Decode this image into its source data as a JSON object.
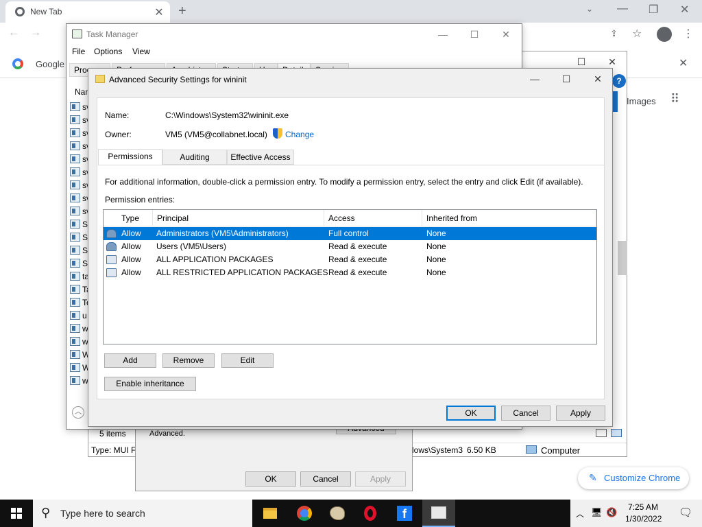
{
  "chrome": {
    "tab_title": "New Tab",
    "bookmark_google": "Google",
    "images_link": "Images",
    "customize_label": "Customize Chrome"
  },
  "task_manager": {
    "title": "Task Manager",
    "menu": [
      "File",
      "Options",
      "View"
    ],
    "tabs": [
      "Processes",
      "Performance",
      "App history",
      "Startup",
      "Users",
      "Details",
      "Services"
    ],
    "column_name": "Nam",
    "rows": [
      "sv",
      "sv",
      "sv",
      "sv",
      "sv",
      "sv",
      "sv",
      "sv",
      "sv",
      "Sy",
      "Sy",
      "Sy",
      "Sy",
      "ta",
      "Ta",
      "Te",
      "u",
      "w",
      "w",
      "W",
      "W",
      "w"
    ],
    "items_count": "5 items"
  },
  "props_window": {
    "status_type": "Type: MUI Fil",
    "status_path": "dows\\System3",
    "status_size": "6.50 KB",
    "status_computer": "Computer"
  },
  "security_dialog": {
    "text": "For special permissions or advanced settings, click Advanced.",
    "advanced_btn": "Advanced",
    "ok": "OK",
    "cancel": "Cancel",
    "apply": "Apply"
  },
  "advanced": {
    "title": "Advanced Security Settings for wininit",
    "name_label": "Name:",
    "name_value": "C:\\Windows\\System32\\wininit.exe",
    "owner_label": "Owner:",
    "owner_value": "VM5 (VM5@collabnet.local)",
    "change_link": "Change",
    "tabs": [
      "Permissions",
      "Auditing",
      "Effective Access"
    ],
    "info_text": "For additional information, double-click a permission entry. To modify a permission entry, select the entry and click Edit (if available).",
    "entries_label": "Permission entries:",
    "columns": [
      "Type",
      "Principal",
      "Access",
      "Inherited from"
    ],
    "entries": [
      {
        "type": "Allow",
        "principal": "Administrators (VM5\\Administrators)",
        "access": "Full control",
        "inherited": "None"
      },
      {
        "type": "Allow",
        "principal": "Users (VM5\\Users)",
        "access": "Read & execute",
        "inherited": "None"
      },
      {
        "type": "Allow",
        "principal": "ALL APPLICATION PACKAGES",
        "access": "Read & execute",
        "inherited": "None"
      },
      {
        "type": "Allow",
        "principal": "ALL RESTRICTED APPLICATION PACKAGES",
        "access": "Read & execute",
        "inherited": "None"
      }
    ],
    "add_btn": "Add",
    "remove_btn": "Remove",
    "edit_btn": "Edit",
    "inheritance_btn": "Enable inheritance",
    "ok_btn": "OK",
    "cancel_btn": "Cancel",
    "apply_btn": "Apply"
  },
  "taskbar": {
    "search_placeholder": "Type here to search",
    "time": "7:25 AM",
    "date": "1/30/2022"
  },
  "colors": {
    "selection": "#0078d7",
    "link": "#0066cc"
  }
}
